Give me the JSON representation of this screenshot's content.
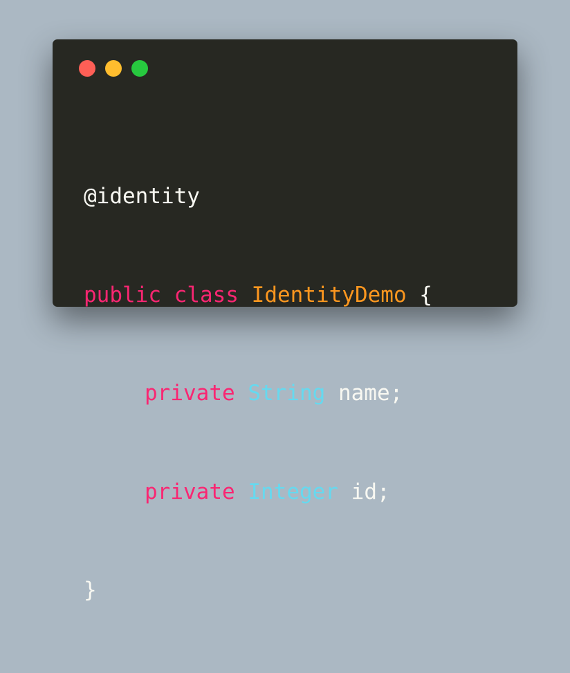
{
  "colors": {
    "background": "#abb8c3",
    "editor": "#272822",
    "text": "#f8f8f2",
    "keyword": "#f92672",
    "class_name": "#fd971f",
    "type": "#66d9ef",
    "dot_red": "#ff5f56",
    "dot_yellow": "#ffbd2e",
    "dot_green": "#27c93f"
  },
  "window_controls": [
    {
      "name": "close",
      "icon": "red-dot-icon"
    },
    {
      "name": "minimize",
      "icon": "yellow-dot-icon"
    },
    {
      "name": "maximize",
      "icon": "green-dot-icon"
    }
  ],
  "code": {
    "line1": {
      "annotation": "@identity"
    },
    "line2": {
      "kw1": "public",
      "kw2": "class",
      "class_name": "IdentityDemo",
      "brace": "{"
    },
    "line3": {
      "kw": "private",
      "type": "String",
      "rest": "name;"
    },
    "line4": {
      "kw": "private",
      "type": "Integer",
      "rest": "id;"
    },
    "line5": {
      "brace": "}"
    }
  }
}
